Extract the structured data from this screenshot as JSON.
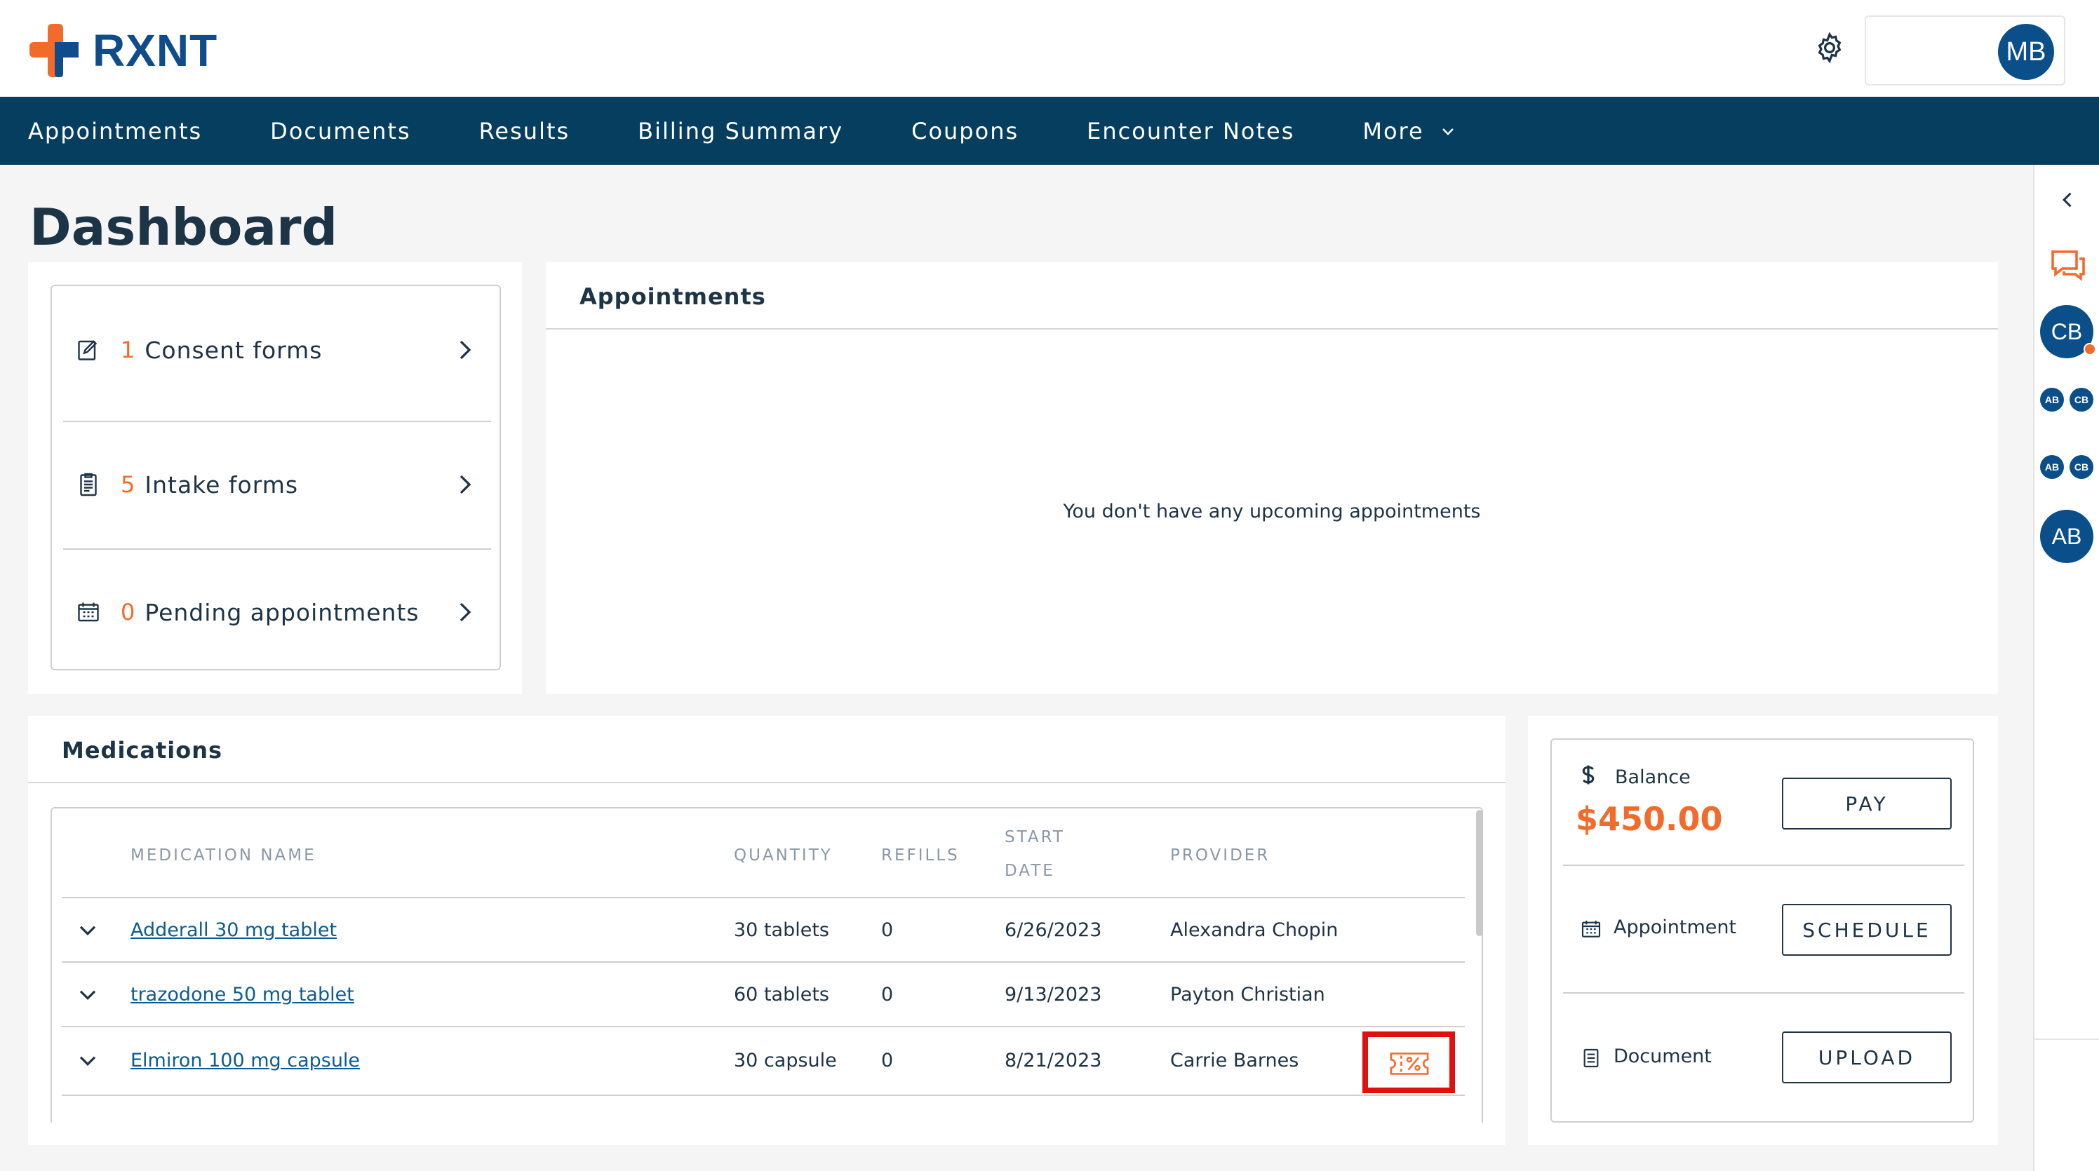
{
  "header": {
    "brand": "RXNT",
    "user_initials": "MB"
  },
  "nav": {
    "items": [
      "Appointments",
      "Documents",
      "Results",
      "Billing Summary",
      "Coupons",
      "Encounter Notes"
    ],
    "more_label": "More"
  },
  "rail": {
    "avatars": [
      {
        "initials": "CB",
        "size": "large",
        "status_dot": true
      },
      {
        "initials": "AB",
        "size": "small"
      },
      {
        "initials": "CB",
        "size": "small"
      },
      {
        "initials": "AB",
        "size": "small"
      },
      {
        "initials": "CB",
        "size": "small"
      },
      {
        "initials": "AB",
        "size": "large"
      }
    ]
  },
  "page": {
    "title": "Dashboard"
  },
  "forms": {
    "items": [
      {
        "count": "1",
        "label": "Consent forms",
        "icon": "consent-form-icon"
      },
      {
        "count": "5",
        "label": "Intake forms",
        "icon": "intake-form-icon"
      },
      {
        "count": "0",
        "label": "Pending appointments",
        "icon": "calendar-icon"
      }
    ]
  },
  "appointments": {
    "title": "Appointments",
    "empty_message": "You don't have any upcoming appointments"
  },
  "medications": {
    "title": "Medications",
    "columns": {
      "name": "MEDICATION NAME",
      "quantity": "QUANTITY",
      "refills": "REFILLS",
      "start_date_1": "START",
      "start_date_2": "DATE",
      "provider": "PROVIDER"
    },
    "rows": [
      {
        "name": "Adderall 30 mg tablet",
        "quantity": "30 tablets",
        "refills": "0",
        "start_date": "6/26/2023",
        "provider": "Alexandra Chopin"
      },
      {
        "name": "trazodone 50 mg tablet",
        "quantity": "60 tablets",
        "refills": "0",
        "start_date": "9/13/2023",
        "provider": "Payton Christian"
      },
      {
        "name": "Elmiron 100 mg capsule",
        "quantity": "30 capsule",
        "refills": "0",
        "start_date": "8/21/2023",
        "provider": "Carrie Barnes",
        "has_coupon": true
      }
    ]
  },
  "billing": {
    "balance_label": "Balance",
    "balance_amount": "$450.00",
    "pay_label": "PAY",
    "appointment_label": "Appointment",
    "schedule_label": "SCHEDULE",
    "document_label": "Document",
    "upload_label": "UPLOAD"
  },
  "colors": {
    "nav_bg": "#063e5f",
    "accent_orange": "#f26b2b",
    "brand_blue": "#0f4c8c",
    "link_blue": "#0b5c94",
    "highlight_red": "#e01010"
  }
}
